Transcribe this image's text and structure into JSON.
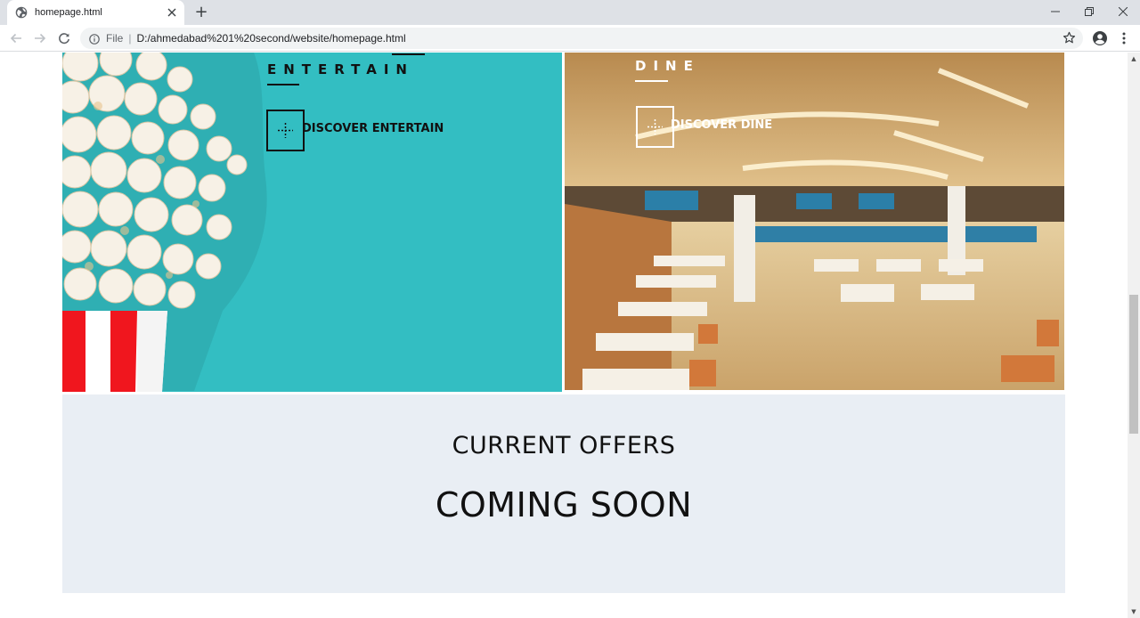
{
  "browser": {
    "tab_title": "homepage.html",
    "new_tab_label": "+",
    "omnibox": {
      "scheme_label": "File",
      "url": "D:/ahmedabad%201%20second/website/homepage.html"
    },
    "icons": {
      "favicon": "globe-icon",
      "back": "arrow-left-icon",
      "forward": "arrow-right-icon",
      "reload": "reload-icon",
      "info": "info-icon",
      "star": "star-icon",
      "profile": "account-circle-icon",
      "menu": "more-vert-icon",
      "minimize": "minimize-icon",
      "maximize": "maximize-icon",
      "close": "close-icon"
    }
  },
  "page": {
    "entertain": {
      "heading": "ENTERTAIN",
      "discover_label": "DISCOVER ENTERTAIN",
      "background_color": "#33bec2",
      "text_color": "#111111"
    },
    "dine": {
      "heading": "DINE",
      "discover_label": "DISCOVER DINE",
      "text_color": "#ffffff"
    },
    "offers": {
      "title": "CURRENT OFFERS",
      "status": "COMING SOON",
      "background_color": "#e9eef4"
    }
  }
}
